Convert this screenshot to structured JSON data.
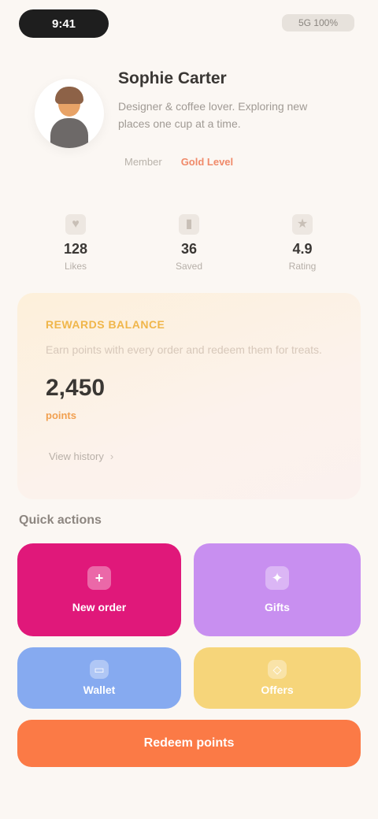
{
  "status_bar": {
    "left_pill": "9:41",
    "right": "5G 100%"
  },
  "profile": {
    "name": "Sophie Carter",
    "bio": "Designer & coffee lover. Exploring new places one cup at a time.",
    "tag_primary": "Member",
    "tag_accent": "Gold Level"
  },
  "stats": [
    {
      "icon": "heart-icon",
      "value": "128",
      "label": "Likes"
    },
    {
      "icon": "bookmark-icon",
      "value": "36",
      "label": "Saved"
    },
    {
      "icon": "star-icon",
      "value": "4.9",
      "label": "Rating"
    }
  ],
  "promo": {
    "kicker": "REWARDS BALANCE",
    "text": "Earn points with every order and redeem them for treats.",
    "amount": "2,450",
    "sub": "points",
    "link": "View history",
    "link_chevron": "›"
  },
  "quick_actions": {
    "title": "Quick actions",
    "tiles": [
      {
        "icon": "plus-icon",
        "glyph": "+",
        "label": "New order",
        "color": "#e0187a"
      },
      {
        "icon": "gift-icon",
        "glyph": "✦",
        "label": "Gifts",
        "color": "#c88ff0"
      },
      {
        "icon": "card-icon",
        "glyph": "▭",
        "label": "Wallet",
        "color": "#86aaf0"
      },
      {
        "icon": "ticket-icon",
        "glyph": "◇",
        "label": "Offers",
        "color": "#f6d57a"
      }
    ],
    "cta": "Redeem points",
    "cta_color": "#fb7a46"
  }
}
